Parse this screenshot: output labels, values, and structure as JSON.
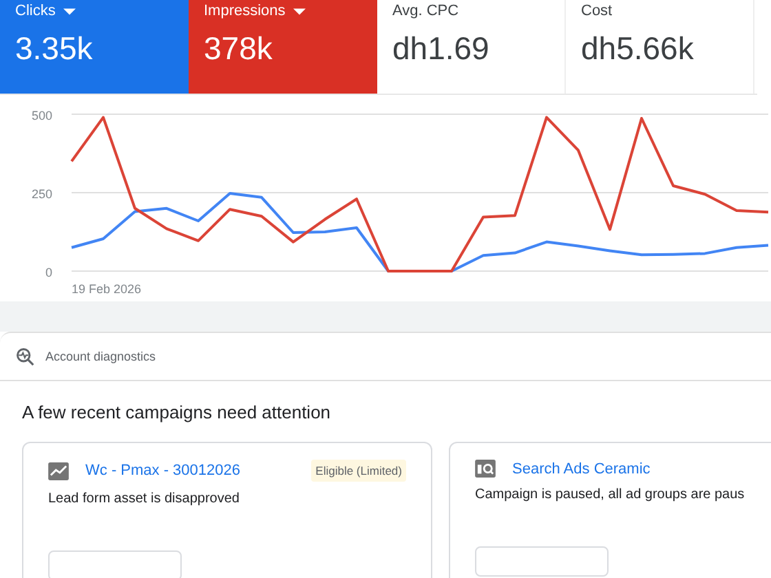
{
  "metrics": [
    {
      "label": "Clicks",
      "value": "3.35k",
      "selected": true,
      "color": "#1a73e8"
    },
    {
      "label": "Impressions",
      "value": "378k",
      "selected": true,
      "color": "#d93025"
    },
    {
      "label": "Avg. CPC",
      "value": "dh1.69",
      "selected": false
    },
    {
      "label": "Cost",
      "value": "dh5.66k",
      "selected": false
    }
  ],
  "chart": {
    "start_date": "19 Feb 2026",
    "chart_data": {
      "type": "line",
      "ylim": [
        0,
        500
      ],
      "yticks": [
        {
          "value": 0,
          "label": "0"
        },
        {
          "value": 250,
          "label": "250"
        },
        {
          "value": 500,
          "label": "500"
        }
      ],
      "series": [
        {
          "color": "#4285f4",
          "values": [
            75,
            103,
            190,
            200,
            160,
            248,
            235,
            123,
            125,
            138,
            0,
            0,
            0,
            50,
            58,
            93,
            80,
            65,
            52,
            53,
            56,
            75,
            82
          ]
        },
        {
          "color": "#db4437",
          "values": [
            350,
            490,
            200,
            135,
            97,
            197,
            175,
            93,
            165,
            230,
            0,
            0,
            0,
            172,
            177,
            490,
            385,
            133,
            487,
            272,
            245,
            193,
            188
          ]
        }
      ]
    }
  },
  "diagnostics": {
    "title": "Account diagnostics",
    "heading": "A few recent campaigns need attention",
    "cards": [
      {
        "kind": "pmax",
        "name": "Wc - Pmax - 30012026",
        "status": "Eligible (Limited)",
        "message": "Lead form asset is disapproved"
      },
      {
        "kind": "search",
        "name": "Search Ads Ceramic",
        "message": "Campaign is paused, all ad groups are paus"
      }
    ]
  }
}
